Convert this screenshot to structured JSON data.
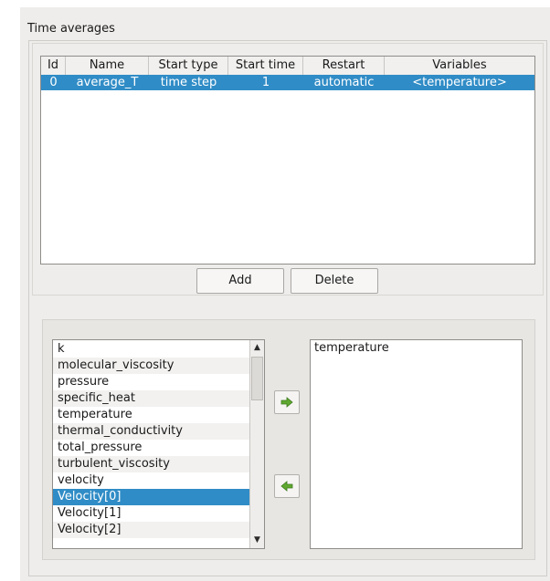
{
  "group": {
    "title": "Time averages"
  },
  "table": {
    "columns": [
      "Id",
      "Name",
      "Start type",
      "Start time",
      "Restart",
      "Variables"
    ],
    "rows": [
      {
        "id": "0",
        "name": "average_T",
        "start_type": "time step",
        "start_time": "1",
        "restart": "automatic",
        "variables": "<temperature>"
      }
    ],
    "selected_color": "#308cc6"
  },
  "buttons": {
    "add": "Add",
    "delete": "Delete"
  },
  "available_variables": [
    "k",
    "molecular_viscosity",
    "pressure",
    "specific_heat",
    "temperature",
    "thermal_conductivity",
    "total_pressure",
    "turbulent_viscosity",
    "velocity",
    "Velocity[0]",
    "Velocity[1]",
    "Velocity[2]"
  ],
  "available_selected": "Velocity[0]",
  "selected_variables": [
    "temperature"
  ],
  "icons": {
    "add_arrow": "green-right-arrow-icon",
    "remove_arrow": "green-left-arrow-icon"
  }
}
